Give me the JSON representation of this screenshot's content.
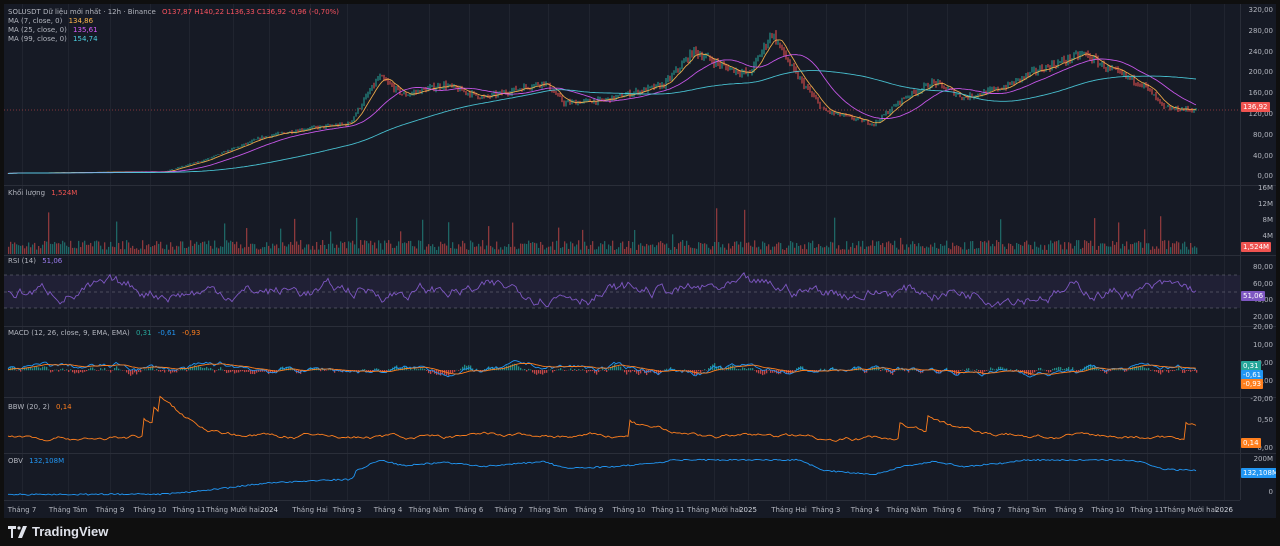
{
  "header": {
    "symbol_line": "SOLUSDT Dữ liệu mới nhất · 12h · Binance",
    "ohlc": "O137,87 H140,22 L136,33 C136,92 -0,96 (-0,70%)"
  },
  "indicators": {
    "ma7": {
      "label": "MA (7, close, 0)",
      "value": "134,86",
      "color": "#f7525f"
    },
    "ma25": {
      "label": "MA (25, close, 0)",
      "value": "135,61",
      "color": "#d65cfb"
    },
    "ma99": {
      "label": "MA (99, close, 0)",
      "value": "154,74",
      "color": "#4dd0e1"
    },
    "volume": {
      "label": "Khối lượng",
      "value": "1,524M"
    },
    "rsi": {
      "label": "RSI (14)",
      "value": "51,06",
      "color": "#7e57c2"
    },
    "macd": {
      "label": "MACD (12, 26, close, 9, EMA, EMA)",
      "v1": "0,31",
      "v2": "-0,61",
      "v3": "-0,93"
    },
    "bbw": {
      "label": "BBW (20, 2)",
      "value": "0,14",
      "color": "#ff7f1e"
    },
    "obv": {
      "label": "OBV",
      "value": "132,108M",
      "color": "#2196f3"
    }
  },
  "axis": {
    "price_ticks": [
      "320,00",
      "280,00",
      "240,00",
      "200,00",
      "160,00",
      "120,00",
      "80,00",
      "40,00",
      "0,00"
    ],
    "volume_ticks": [
      "16M",
      "12M",
      "8M",
      "4M"
    ],
    "rsi_ticks": [
      "80,00",
      "60,00",
      "40,00",
      "20,00"
    ],
    "macd_ticks": [
      "20,00",
      "10,00",
      "0,00",
      "-10,00",
      "-20,00"
    ],
    "bbw_ticks": [
      "0,50",
      "0,00"
    ],
    "obv_ticks": [
      "200M",
      "100M",
      "0"
    ],
    "x_labels": [
      "Tháng 7",
      "Tháng Tám",
      "Tháng 9",
      "Tháng 10",
      "Tháng 11",
      "Tháng Mười hai",
      "2024",
      "Tháng Hai",
      "Tháng 3",
      "Tháng 4",
      "Tháng Năm",
      "Tháng 6",
      "Tháng 7",
      "Tháng Tám",
      "Tháng 9",
      "Tháng 10",
      "Tháng 11",
      "Tháng Mười hai",
      "2025",
      "Tháng Hai",
      "Tháng 3",
      "Tháng 4",
      "Tháng Năm",
      "Tháng 6",
      "Tháng 7",
      "Tháng Tám",
      "Tháng 9",
      "Tháng 10",
      "Tháng 11",
      "Tháng Mười hai",
      "2026"
    ]
  },
  "tags": {
    "price": "136,92",
    "volume": "1,524M",
    "rsi": "51,06",
    "macd1": "0,31",
    "macd2": "-0,61",
    "macd3": "-0,93",
    "bbw": "0,14",
    "obv": "132,108M"
  },
  "colors": {
    "up": "#26a69a",
    "down": "#ef5350",
    "background": "#161a25"
  },
  "footer": {
    "brand": "TradingView"
  }
}
